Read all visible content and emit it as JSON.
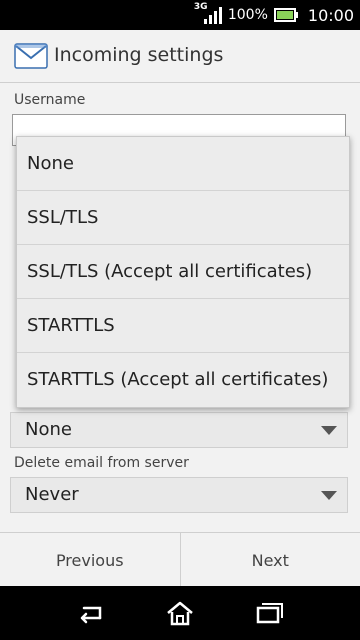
{
  "status_bar": {
    "network": "3G",
    "battery_percent": "100%",
    "time": "10:00"
  },
  "app_bar": {
    "icon": "email-envelope-icon",
    "title": "Incoming settings"
  },
  "form": {
    "username_label": "Username",
    "username_value": "",
    "delete_label": "Delete email from server",
    "delete_value": "Never",
    "security_value": "None"
  },
  "dropdown": {
    "options": [
      "None",
      "SSL/TLS",
      "SSL/TLS (Accept all certificates)",
      "STARTTLS",
      "STARTTLS (Accept all certificates)"
    ]
  },
  "buttons": {
    "previous": "Previous",
    "next": "Next"
  },
  "nav_bar": {
    "back_icon": "back-icon",
    "home_icon": "home-icon",
    "recents_icon": "recent-apps-icon"
  },
  "colors": {
    "battery_fill": "#8bd35a",
    "envelope": "#3a6fb0"
  }
}
